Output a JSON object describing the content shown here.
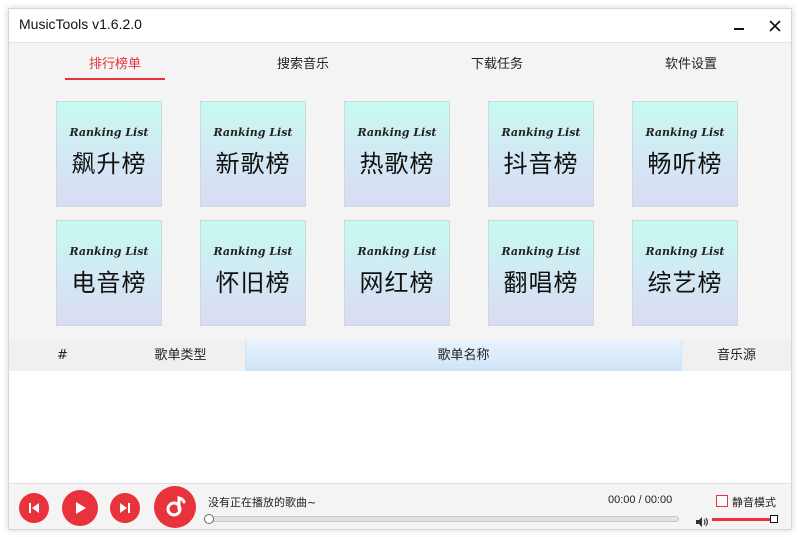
{
  "window": {
    "title": "MusicTools v1.6.2.0"
  },
  "tabs": [
    {
      "label": "排行榜单",
      "active": true
    },
    {
      "label": "搜索音乐",
      "active": false
    },
    {
      "label": "下载任务",
      "active": false
    },
    {
      "label": "软件设置",
      "active": false
    }
  ],
  "tiles": [
    {
      "subtitle": "Ranking List",
      "name": "飙升榜"
    },
    {
      "subtitle": "Ranking List",
      "name": "新歌榜"
    },
    {
      "subtitle": "Ranking List",
      "name": "热歌榜"
    },
    {
      "subtitle": "Ranking List",
      "name": "抖音榜"
    },
    {
      "subtitle": "Ranking List",
      "name": "畅听榜"
    },
    {
      "subtitle": "Ranking List",
      "name": "电音榜"
    },
    {
      "subtitle": "Ranking List",
      "name": "怀旧榜"
    },
    {
      "subtitle": "Ranking List",
      "name": "网红榜"
    },
    {
      "subtitle": "Ranking List",
      "name": "翻唱榜"
    },
    {
      "subtitle": "Ranking List",
      "name": "综艺榜"
    }
  ],
  "table": {
    "columns": [
      "#",
      "歌单类型",
      "歌单名称",
      "音乐源"
    ],
    "rows": []
  },
  "player": {
    "song": "没有正在播放的歌曲~",
    "time": "00:00 / 00:00",
    "progress": 0,
    "mute_label": "静音模式",
    "mute_checked": false,
    "volume": 1.0
  },
  "colors": {
    "accent": "#e8323c",
    "tile_top": "#c6fbf0",
    "tile_bottom": "#d9dcf3"
  }
}
